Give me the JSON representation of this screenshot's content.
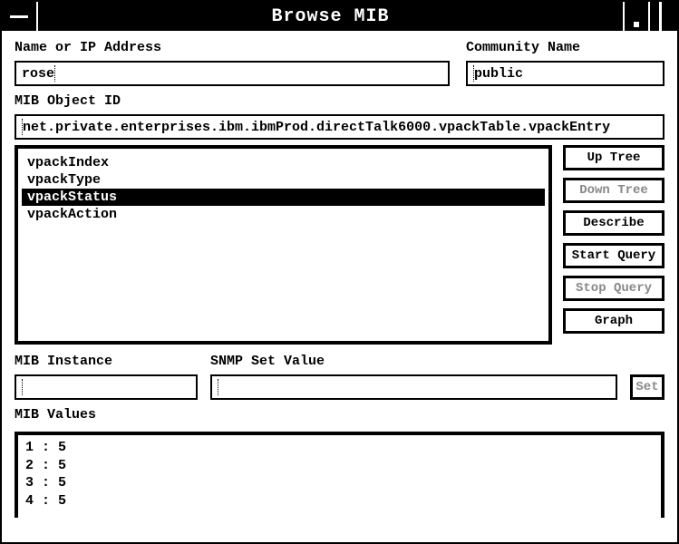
{
  "window": {
    "title": "Browse MIB"
  },
  "labels": {
    "name_or_ip": "Name or IP Address",
    "community": "Community Name",
    "mib_object_id": "MIB Object ID",
    "mib_instance": "MIB Instance",
    "snmp_set_value": "SNMP Set Value",
    "mib_values": "MIB Values"
  },
  "fields": {
    "name_or_ip": "rose",
    "community": "public",
    "mib_object_id": "net.private.enterprises.ibm.ibmProd.directTalk6000.vpackTable.vpackEntry",
    "mib_instance": "",
    "snmp_set_value": ""
  },
  "object_list": {
    "items": [
      "vpackIndex",
      "vpackType",
      "vpackStatus",
      "vpackAction"
    ],
    "selected_index": 2
  },
  "buttons": {
    "up_tree": "Up Tree",
    "down_tree": "Down Tree",
    "describe": "Describe",
    "start_query": "Start Query",
    "stop_query": "Stop Query",
    "graph": "Graph",
    "set": "Set"
  },
  "mib_values": [
    "1 : 5",
    "2 : 5",
    "3 : 5",
    "4 : 5"
  ]
}
